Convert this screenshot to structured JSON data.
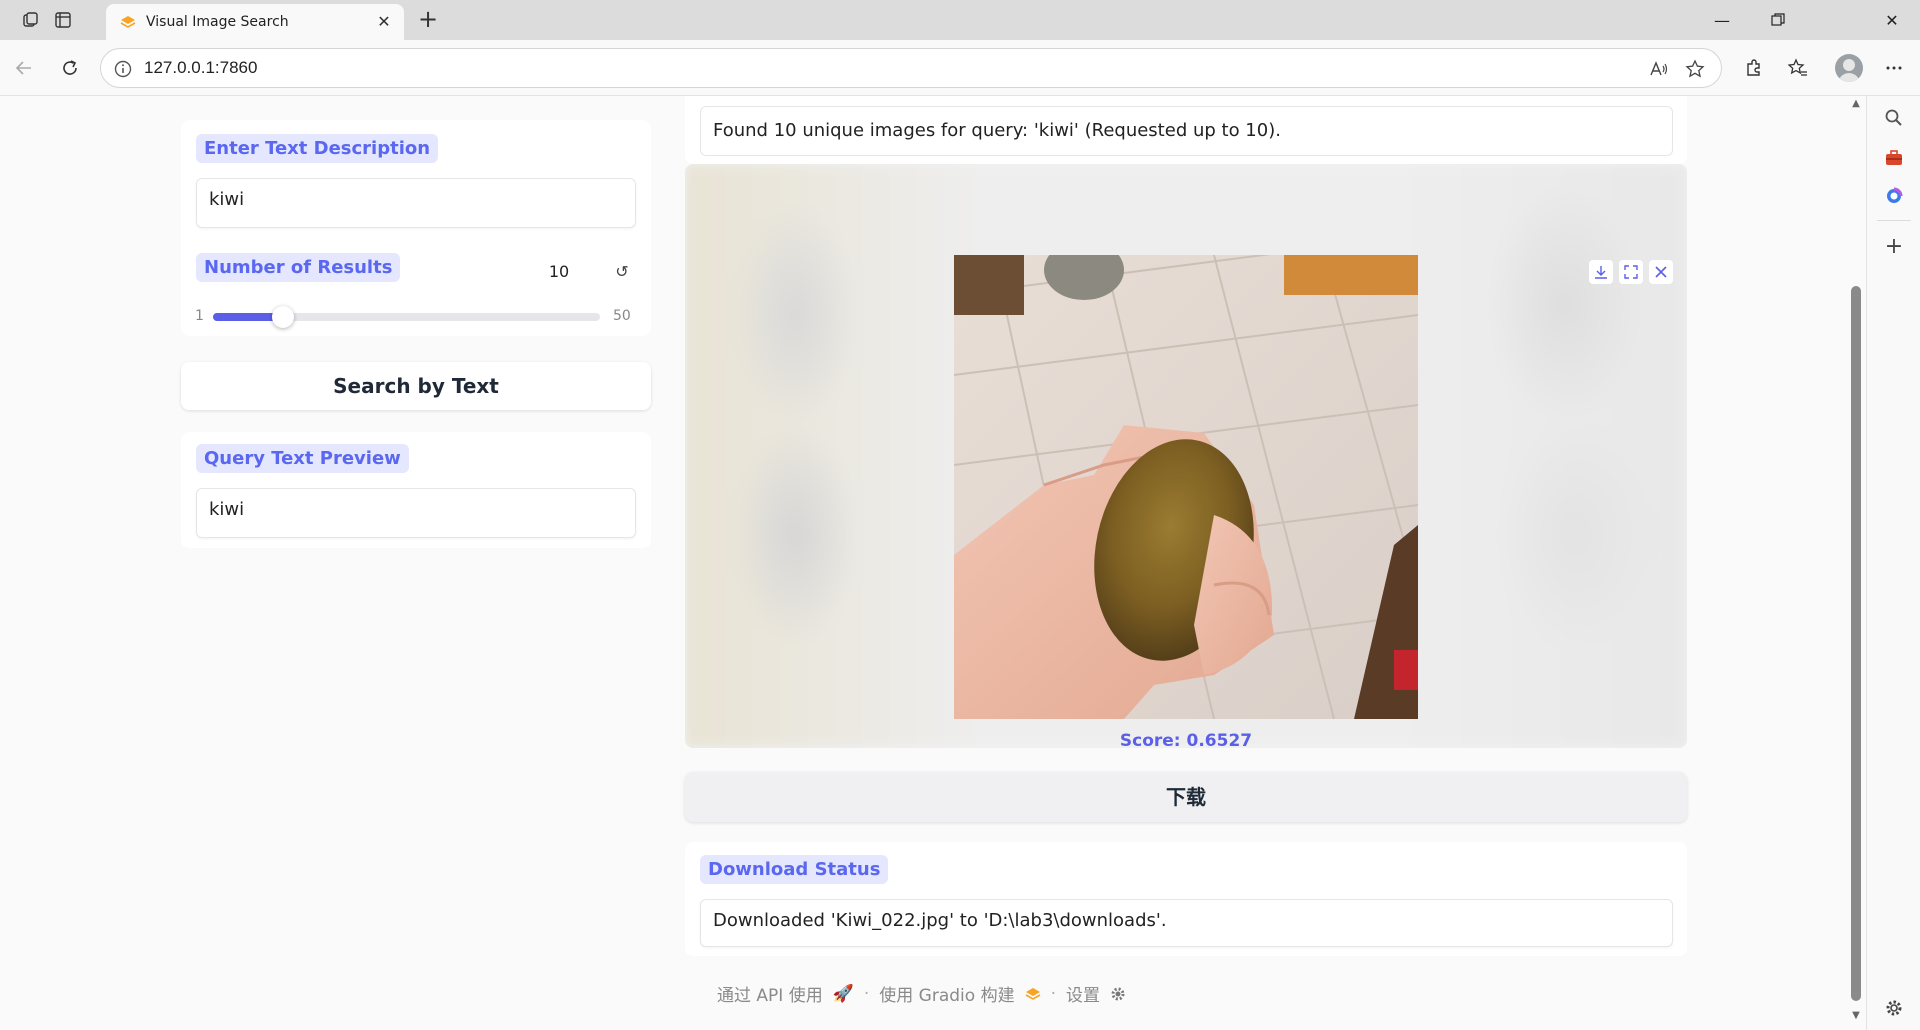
{
  "browser": {
    "tab_title": "Visual Image Search",
    "url": "127.0.0.1:7860"
  },
  "left": {
    "text_label": "Enter Text Description",
    "text_value": "kiwi",
    "results_label": "Number of Results",
    "results_value": "10",
    "slider_min": "1",
    "slider_max": "50",
    "slider_fraction": 0.18,
    "search_button": "Search by Text",
    "preview_label": "Query Text Preview",
    "preview_value": "kiwi"
  },
  "right": {
    "status_text": "Found 10 unique images for query: 'kiwi' (Requested up to 10).",
    "score_text": "Score: 0.6527",
    "thumb_count": 10,
    "selected_thumb": 1,
    "download_button": "下载",
    "download_label": "Download Status",
    "download_text": "Downloaded 'Kiwi_022.jpg' to 'D:\\lab3\\downloads'."
  },
  "footer": {
    "api": "通过 API 使用",
    "built": "使用 Gradio 构建",
    "settings": "设置"
  },
  "colors": {
    "accent": "#5b5fe8",
    "chip_bg": "#e4e7fd"
  }
}
